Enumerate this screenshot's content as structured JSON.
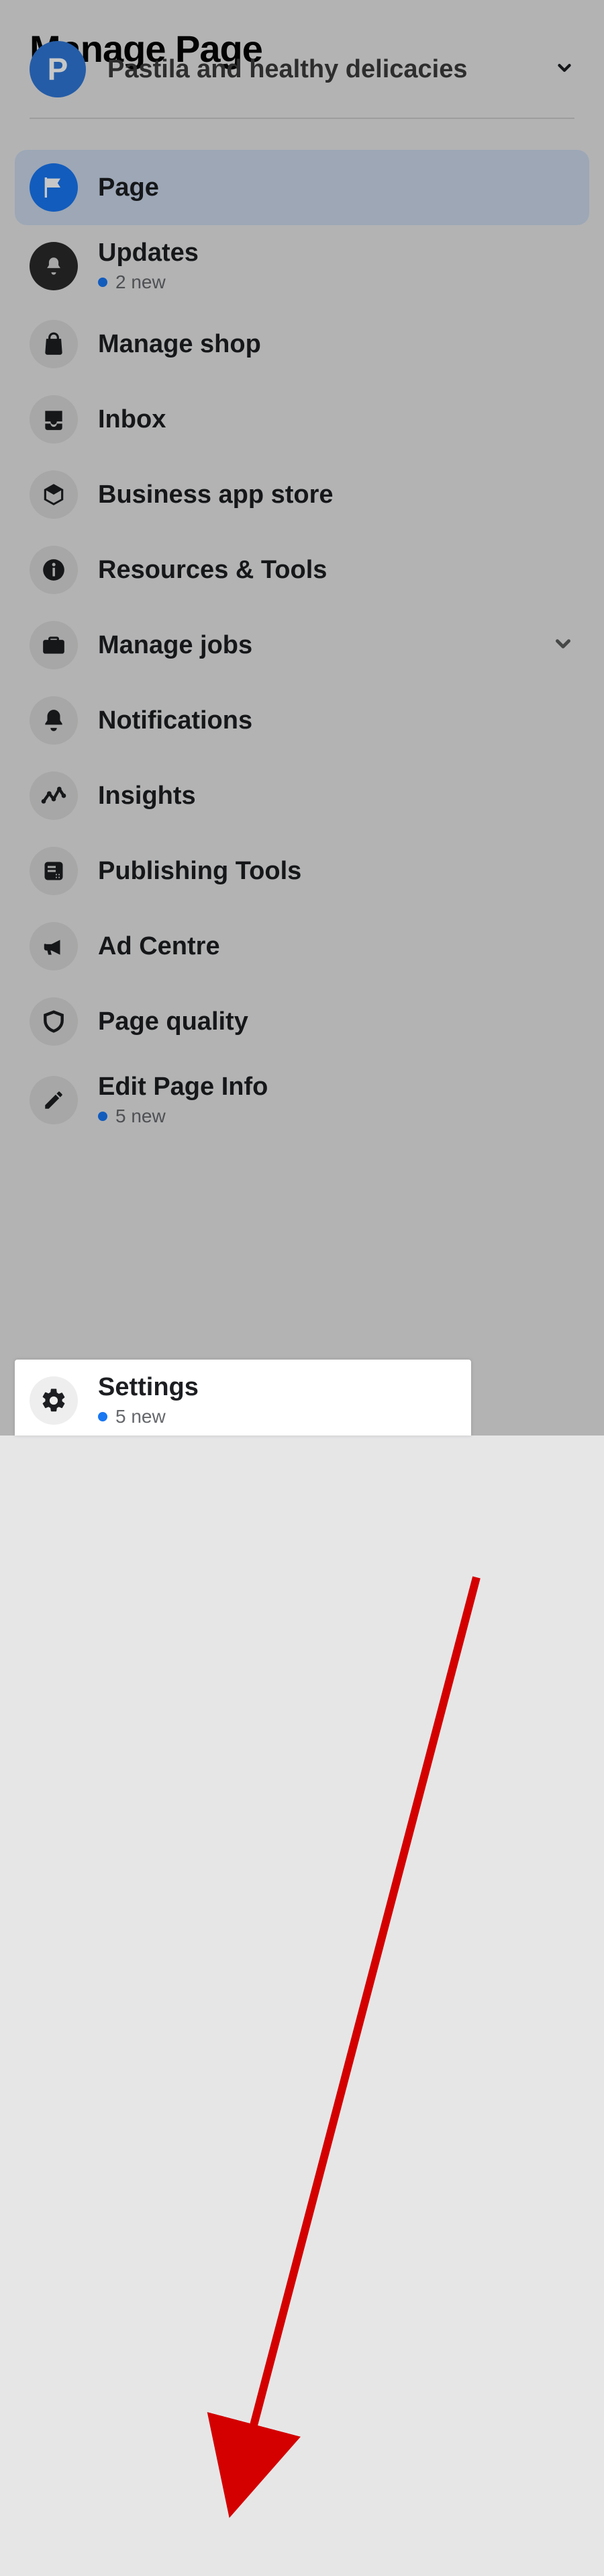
{
  "title": "Manage Page",
  "page_selector": {
    "avatar_letter": "P",
    "name": "Pastila and healthy delicacies"
  },
  "nav": {
    "page": {
      "label": "Page"
    },
    "updates": {
      "label": "Updates",
      "sub": "2 new"
    },
    "manage_shop": {
      "label": "Manage shop"
    },
    "inbox": {
      "label": "Inbox"
    },
    "business_apps": {
      "label": "Business app store"
    },
    "resources": {
      "label": "Resources & Tools"
    },
    "manage_jobs": {
      "label": "Manage jobs"
    },
    "notifications": {
      "label": "Notifications"
    },
    "insights": {
      "label": "Insights"
    },
    "publishing_tools": {
      "label": "Publishing Tools"
    },
    "ad_centre": {
      "label": "Ad Centre"
    },
    "page_quality": {
      "label": "Page quality"
    },
    "edit_page_info": {
      "label": "Edit Page Info",
      "sub": "5 new"
    },
    "settings": {
      "label": "Settings",
      "sub": "5 new"
    }
  }
}
